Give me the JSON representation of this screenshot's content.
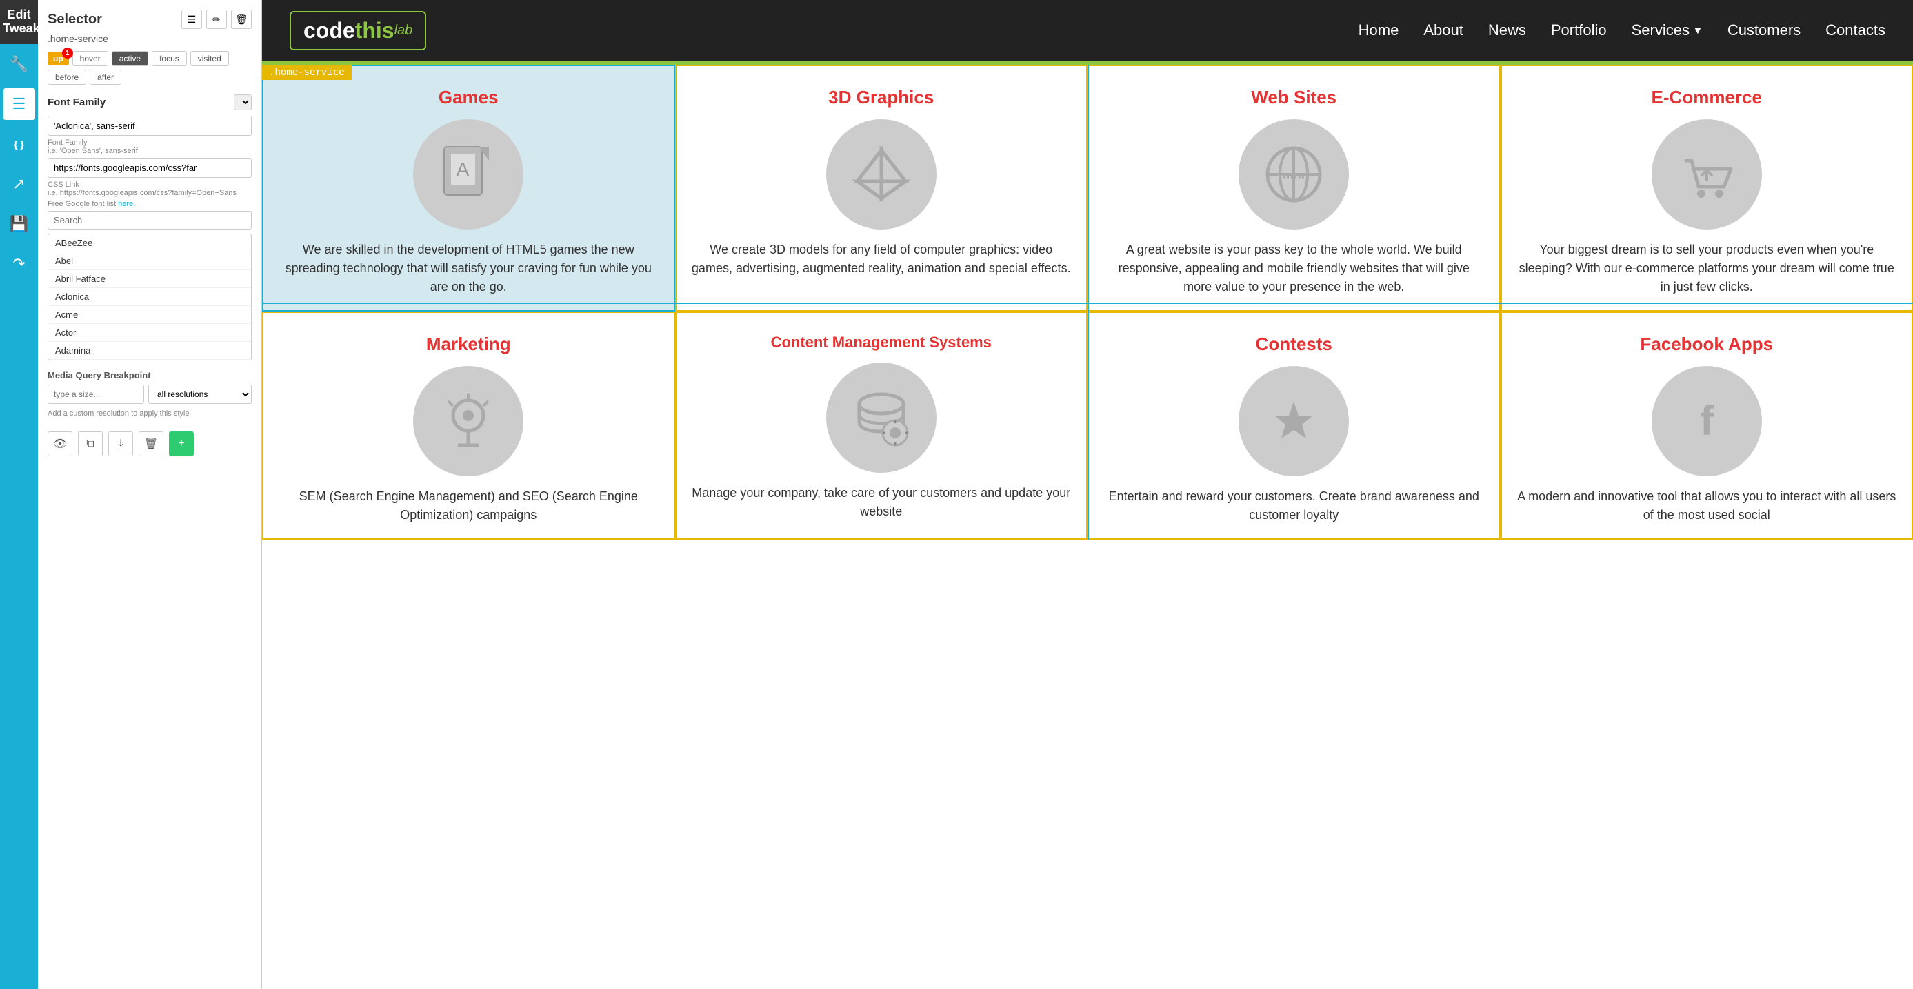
{
  "leftPanel": {
    "editTweak": "Edit\nTweak",
    "selectorTitle": "Selector",
    "selectorClass": ".home-service",
    "badges": {
      "up": "up",
      "upCount": "1",
      "states": [
        "hover",
        "active",
        "focus",
        "visited",
        "before",
        "after"
      ]
    },
    "fontFamily": {
      "sectionLabel": "Font Family",
      "currentValue": "'Aclonica', sans-serif",
      "hintLabel": "Font Family",
      "hintExample": "i.e. 'Open Sans', sans-serif",
      "cssLink": "https://fonts.googleapis.com/css?far",
      "cssLinkHint": "CSS Link",
      "cssLinkExample": "i.e. https://fonts.googleapis.com/css?family=Open+Sans",
      "googleFontsText": "Free Google font list",
      "googleFontsLinkText": "here.",
      "searchPlaceholder": "Search",
      "fonts": [
        "ABeeZee",
        "Abel",
        "Abril Fatface",
        "Aclonica",
        "Acme",
        "Actor",
        "Adamina"
      ]
    },
    "mediaQuery": {
      "sectionLabel": "Media Query Breakpoint",
      "inputPlaceholder": "type a size...",
      "selectDefault": "all resolutions",
      "hint": "Add a custom resolution to apply this style"
    },
    "bottomToolbar": {
      "eyeIcon": "👁",
      "copyIcon": "⧉",
      "downloadIcon": "⤓",
      "deleteIcon": "🗑",
      "addIcon": "+"
    }
  },
  "iconBar": {
    "icons": [
      {
        "name": "wrench-icon",
        "symbol": "🔧"
      },
      {
        "name": "sliders-icon",
        "symbol": "⊟"
      },
      {
        "name": "code-icon",
        "symbol": "{ }"
      },
      {
        "name": "arrow-icon",
        "symbol": "↗"
      },
      {
        "name": "save-icon",
        "symbol": "💾"
      },
      {
        "name": "share-icon",
        "symbol": "↷"
      }
    ]
  },
  "website": {
    "logo": {
      "code": "code ",
      "this": "this",
      "lab": "lab"
    },
    "nav": {
      "items": [
        "Home",
        "About",
        "News",
        "Portfolio",
        "Services",
        "Customers",
        "Contacts"
      ],
      "dropdownItem": "Services"
    },
    "services": {
      "row1": [
        {
          "title": "Games",
          "icon": "🃏",
          "description": "We are skilled in the development of HTML5 games the new spreading technology that will satisfy your craving for fun while you are on the go.",
          "highlighted": true,
          "selectorLabel": ".home-service"
        },
        {
          "title": "3D Graphics",
          "icon": "📦",
          "description": "We create 3D models for any field of computer graphics: video games, advertising, augmented reality, animation and special effects.",
          "highlighted": false,
          "outlined": true
        },
        {
          "title": "Web Sites",
          "icon": "🌐",
          "description": "A great website is your pass key to the whole world. We build responsive, appealing and mobile friendly websites that will give more value to your presence in the web.",
          "highlighted": false,
          "outlined": true
        },
        {
          "title": "E-Commerce",
          "icon": "🛒",
          "description": "Your biggest dream is to sell your products even when you're sleeping? With our e-commerce platforms your dream will come true in just few clicks.",
          "highlighted": false,
          "outlined": true
        }
      ],
      "row2": [
        {
          "title": "Marketing",
          "icon": "💡",
          "description": "SEM (Search Engine Management) and SEO (Search Engine Optimization) campaigns",
          "highlighted": false,
          "outlined": true
        },
        {
          "title": "Content Management Systems",
          "icon": "🗄",
          "description": "Manage your company, take care of your customers and update your website",
          "highlighted": false,
          "outlined": true
        },
        {
          "title": "Contests",
          "icon": "⭐",
          "description": "Entertain and reward your customers. Create brand awareness and customer loyalty",
          "highlighted": false,
          "outlined": true
        },
        {
          "title": "Facebook Apps",
          "icon": "f",
          "description": "A modern and innovative tool that allows you to interact with all users of the most used social",
          "highlighted": false,
          "outlined": true
        }
      ]
    }
  }
}
